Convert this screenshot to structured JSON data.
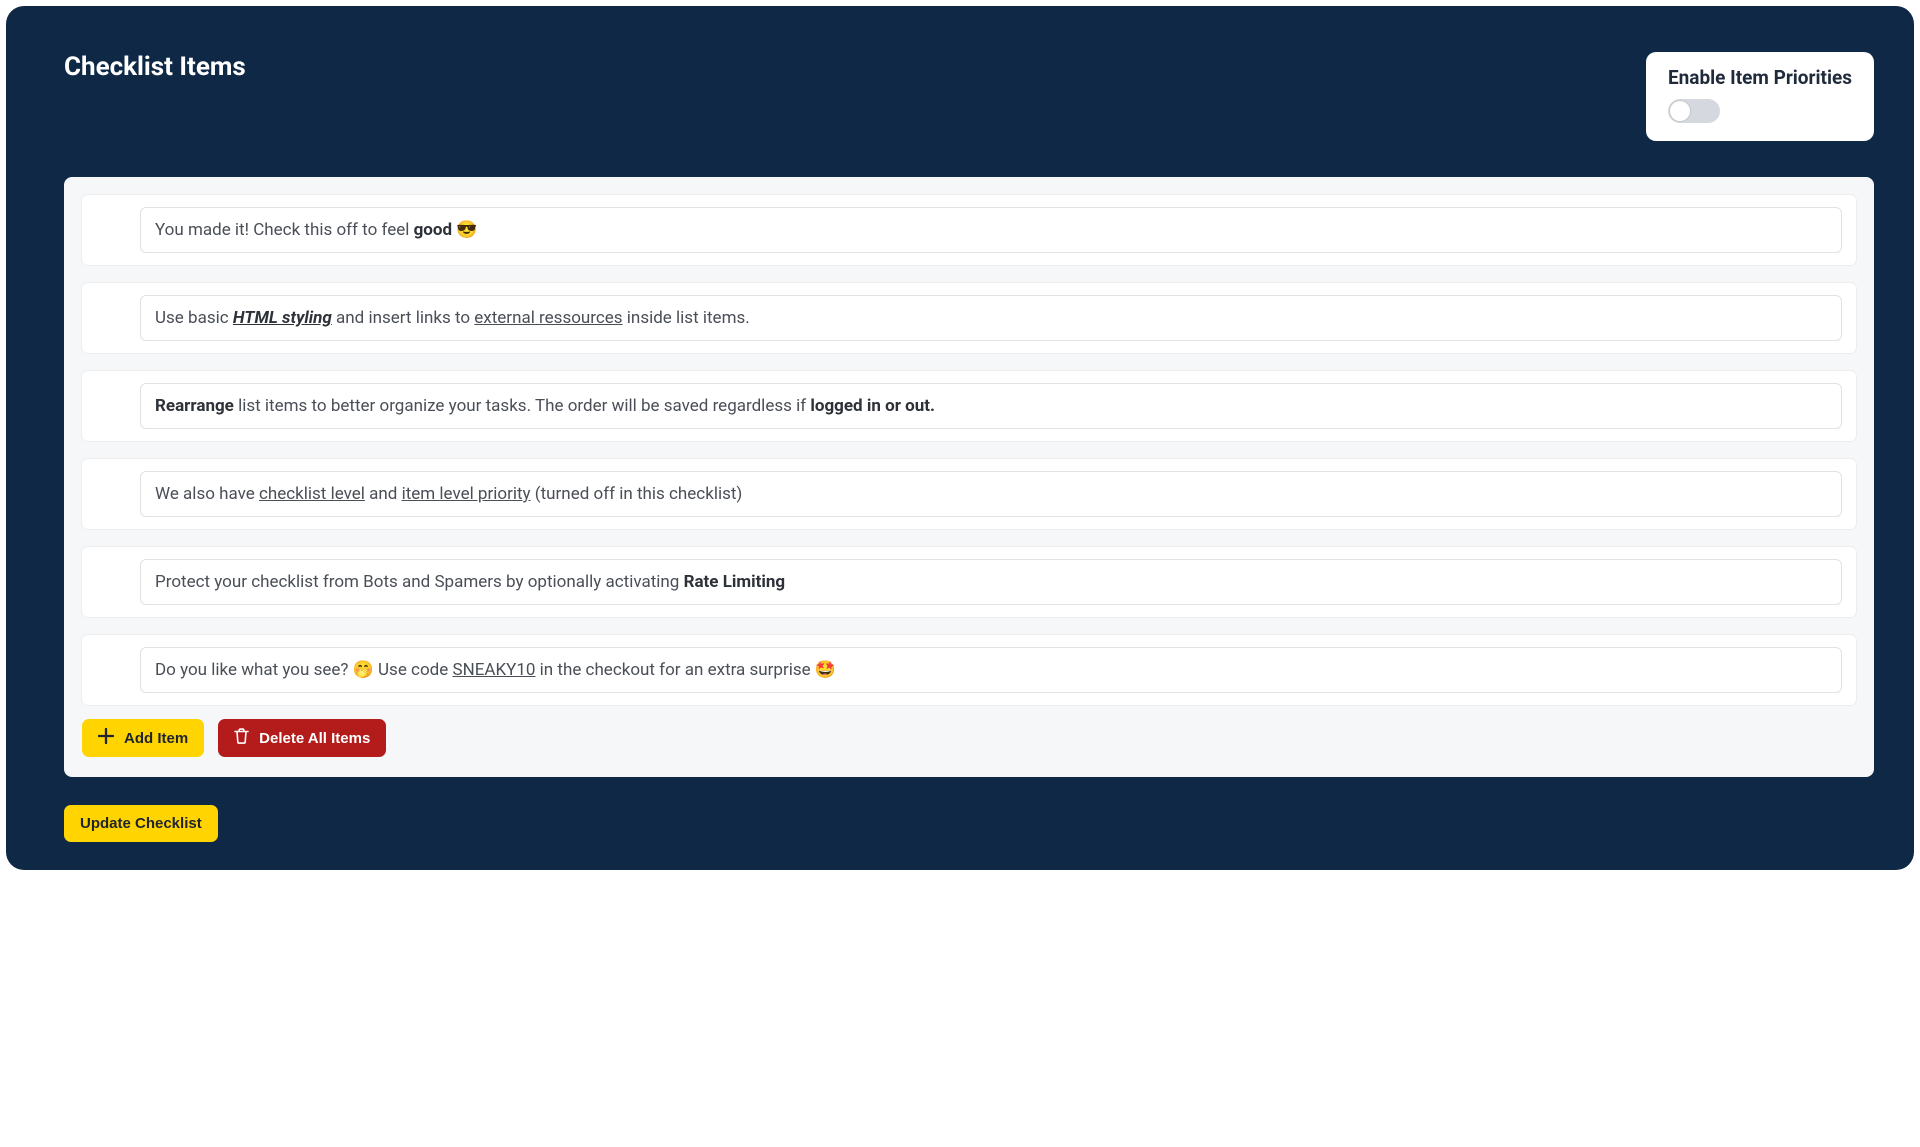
{
  "header": {
    "title": "Checklist Items"
  },
  "priorityCard": {
    "label": "Enable Item Priorities",
    "enabled": false
  },
  "items": [
    {
      "html": "You made it! Check this off to feel <b>good</b> 😎"
    },
    {
      "html": "Use basic <b><em><span class='u'>HTML styling</span></em></b> and insert links to <span class='u'>external ressources</span> inside list items."
    },
    {
      "html": "<b>Rearrange</b> list items to better organize your tasks. The order will be saved regardless if <b>logged in or out.</b>"
    },
    {
      "html": "We also have <span class='u'>checklist level</span> and <span class='u'>item level priority</span> (turned off in this checklist)"
    },
    {
      "html": "Protect your checklist from Bots and Spamers by optionally activating <b>Rate Limiting</b>"
    },
    {
      "html": "Do you like what you see? 🤭 Use code <span class='u'>SNEAKY10</span> in the checkout for an extra surprise 🤩"
    }
  ],
  "buttons": {
    "addItem": "Add Item",
    "deleteAll": "Delete All Items",
    "update": "Update Checklist"
  },
  "icons": {
    "plus": "plus-icon",
    "trash": "trash-icon"
  }
}
